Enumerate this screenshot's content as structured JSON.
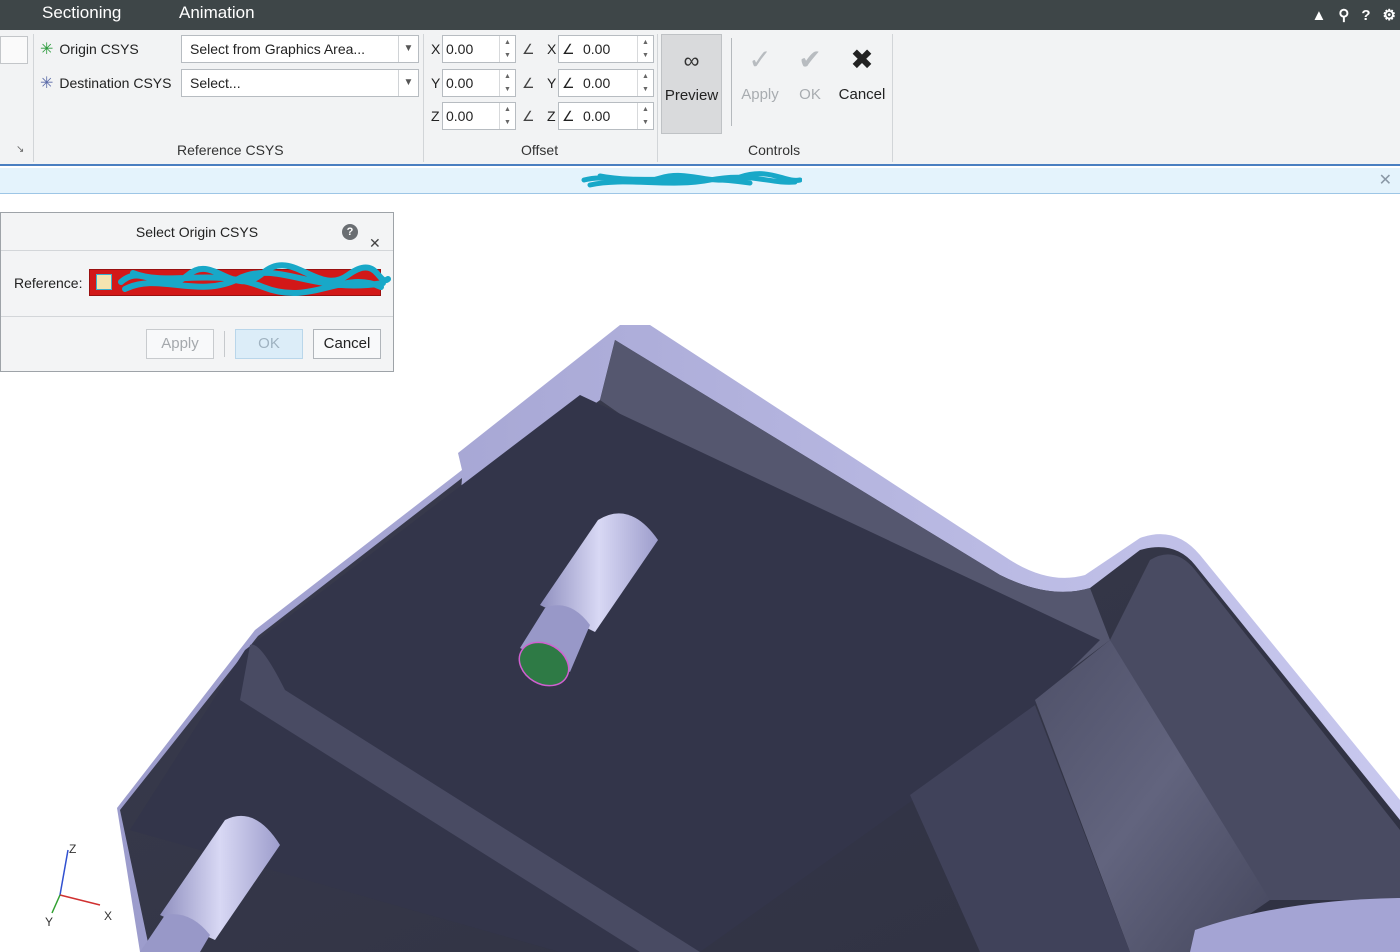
{
  "topbar": {
    "tabs": [
      "Sectioning",
      "Animation"
    ],
    "icons": [
      "caret-up-icon",
      "search-icon",
      "help-icon",
      "settings-icon"
    ]
  },
  "ribbon": {
    "reference_csys": {
      "origin_label": "Origin CSYS",
      "origin_value": "Select from Graphics Area...",
      "destination_label": "Destination CSYS",
      "destination_value": "Select...",
      "group_label": "Reference CSYS"
    },
    "offset": {
      "group_label": "Offset",
      "translations": [
        {
          "axis": "X",
          "value": "0.00"
        },
        {
          "axis": "Y",
          "value": "0.00"
        },
        {
          "axis": "Z",
          "value": "0.00"
        }
      ],
      "rotations": [
        {
          "axis": "X",
          "value": "0.00"
        },
        {
          "axis": "Y",
          "value": "0.00"
        },
        {
          "axis": "Z",
          "value": "0.00"
        }
      ]
    },
    "controls": {
      "group_label": "Controls",
      "preview": "Preview",
      "apply": "Apply",
      "ok": "OK",
      "cancel": "Cancel"
    }
  },
  "dialog": {
    "title": "Select Origin CSYS",
    "reference_label": "Reference:",
    "apply": "Apply",
    "ok": "OK",
    "cancel": "Cancel"
  },
  "triad": {
    "z": "Z",
    "y": "Y",
    "x": "X"
  },
  "colors": {
    "topbar": "#3e4648",
    "ribbon": "#f2f3f4",
    "message_bar": "#e4f3fc",
    "model_dark": "#3c3f55",
    "model_light": "#a8a8d8",
    "selected_face": "#2e7a45",
    "redaction": "#18a8c8",
    "reference_field": "#d21818"
  }
}
